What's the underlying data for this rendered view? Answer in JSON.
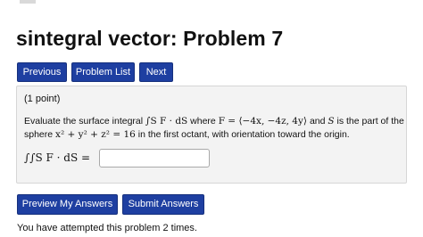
{
  "header": {
    "title": "sintegral vector: Problem 7"
  },
  "nav": {
    "previous_label": "Previous",
    "problem_list_label": "Problem List",
    "next_label": "Next"
  },
  "problem": {
    "points": "(1 point)",
    "statement_text_1": "Evaluate the surface integral",
    "statement_text_2": "where",
    "statement_text_3": "and",
    "statement_text_4": "is the part of the",
    "statement_text_5": "sphere",
    "statement_text_6": "in the first octant, with orientation toward the origin.",
    "integral_expr": "∫S F · dS",
    "F_def": "F = ⟨−4x, −4z, 4y⟩",
    "S_symbol": "S",
    "sphere_eq": "x² + y² + z² = 16",
    "answer_label": "∫∫S F · dS =",
    "answer_value": ""
  },
  "actions": {
    "preview_label": "Preview My Answers",
    "submit_label": "Submit Answers"
  },
  "status": {
    "attempts_text": "You have attempted this problem 2 times."
  }
}
